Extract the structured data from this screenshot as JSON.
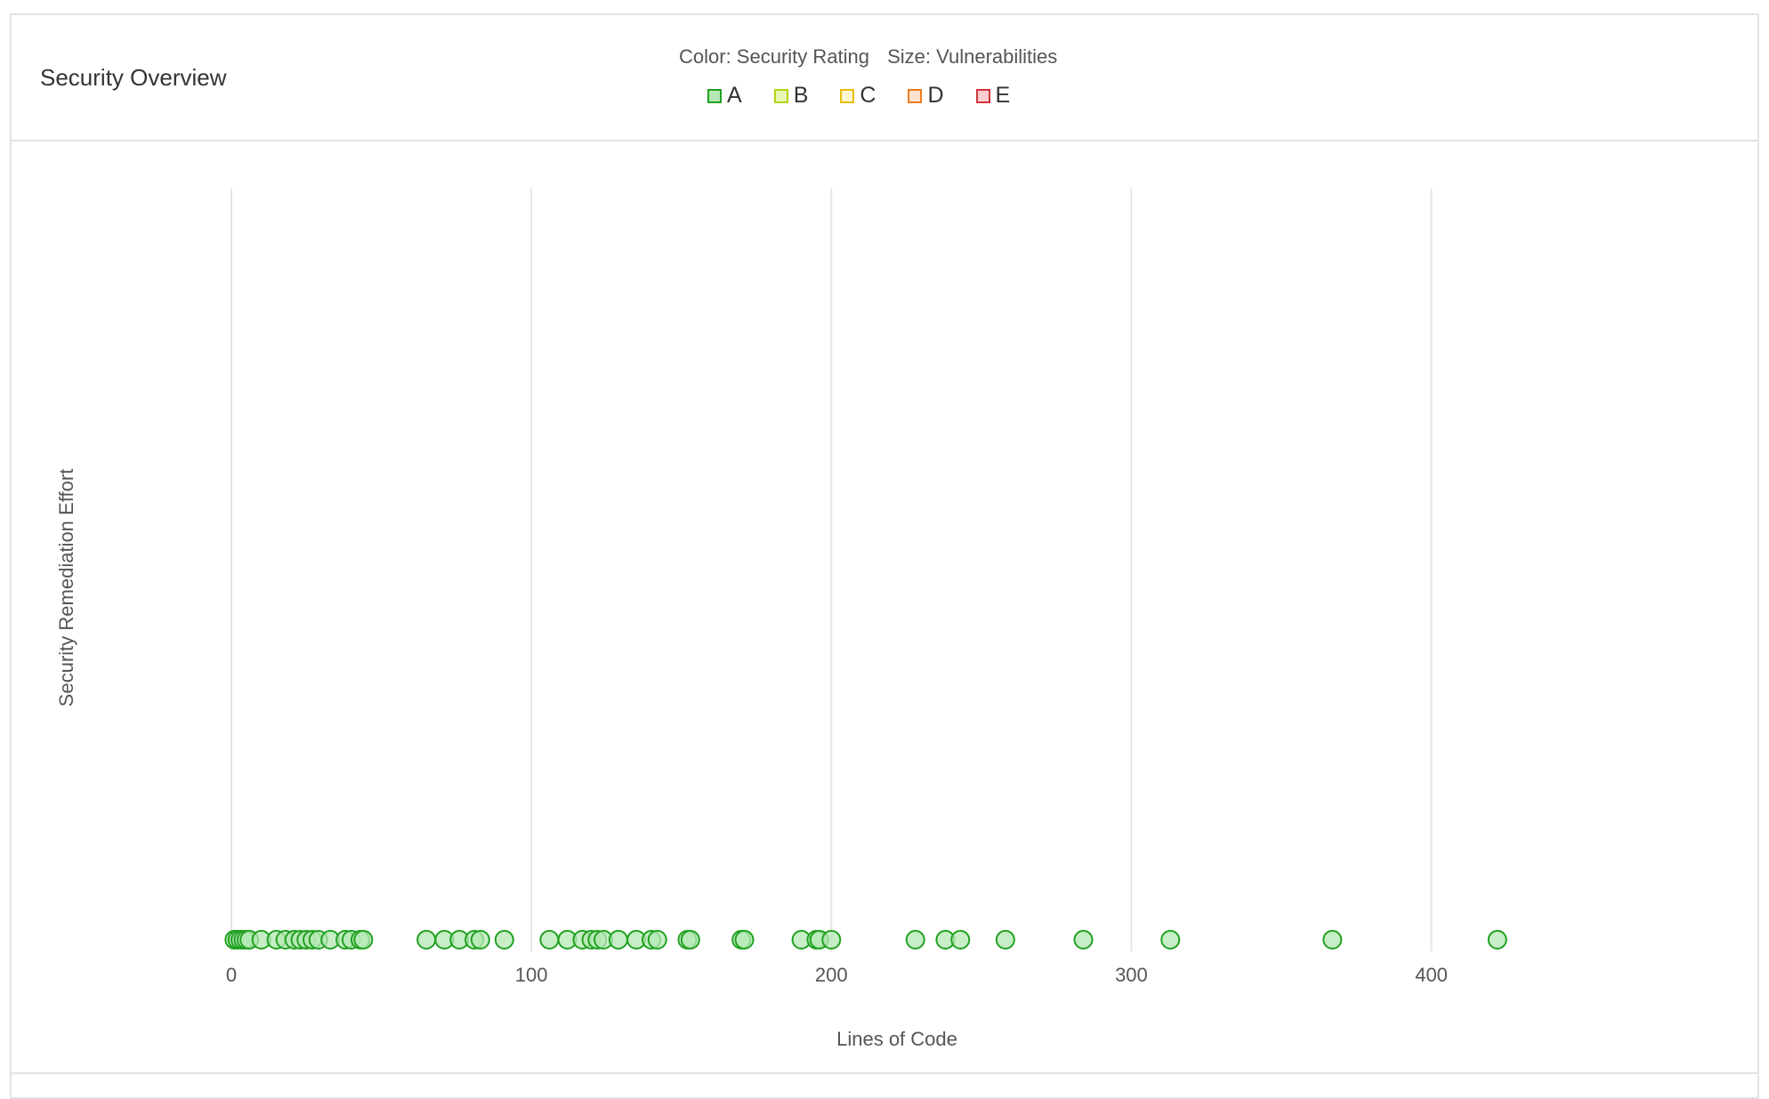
{
  "panel": {
    "title": "Security Overview"
  },
  "legend": {
    "color_caption": "Color: Security Rating",
    "size_caption": "Size: Vulnerabilities",
    "items": [
      {
        "label": "A",
        "fill": "#b4e8b4",
        "stroke": "#21a121"
      },
      {
        "label": "B",
        "fill": "#e8f5b4",
        "stroke": "#b0d513"
      },
      {
        "label": "C",
        "fill": "#fdf5d2",
        "stroke": "#eabe06"
      },
      {
        "label": "D",
        "fill": "#fde3cf",
        "stroke": "#ed7d20"
      },
      {
        "label": "E",
        "fill": "#fbcfd1",
        "stroke": "#d4333f"
      }
    ]
  },
  "chart_data": {
    "type": "scatter",
    "title": "",
    "xlabel": "Lines of Code",
    "ylabel": "Security Remediation Effort",
    "xlim": [
      0,
      420
    ],
    "x_ticks": [
      "0",
      "100",
      "200",
      "300",
      "400"
    ],
    "grid": true,
    "series": [
      {
        "name": "A",
        "color": "#21a121",
        "fill": "#b4e8b4",
        "y": 0,
        "x": [
          1,
          2,
          3,
          4,
          5,
          6,
          10,
          15,
          18,
          21,
          23,
          25,
          27,
          29,
          33,
          38,
          40,
          43,
          44,
          65,
          71,
          76,
          81,
          83,
          91,
          106,
          112,
          117,
          120,
          122,
          124,
          129,
          135,
          140,
          142,
          152,
          153,
          170,
          171,
          190,
          195,
          196,
          200,
          228,
          238,
          243,
          258,
          284,
          313,
          367,
          422
        ]
      }
    ]
  }
}
